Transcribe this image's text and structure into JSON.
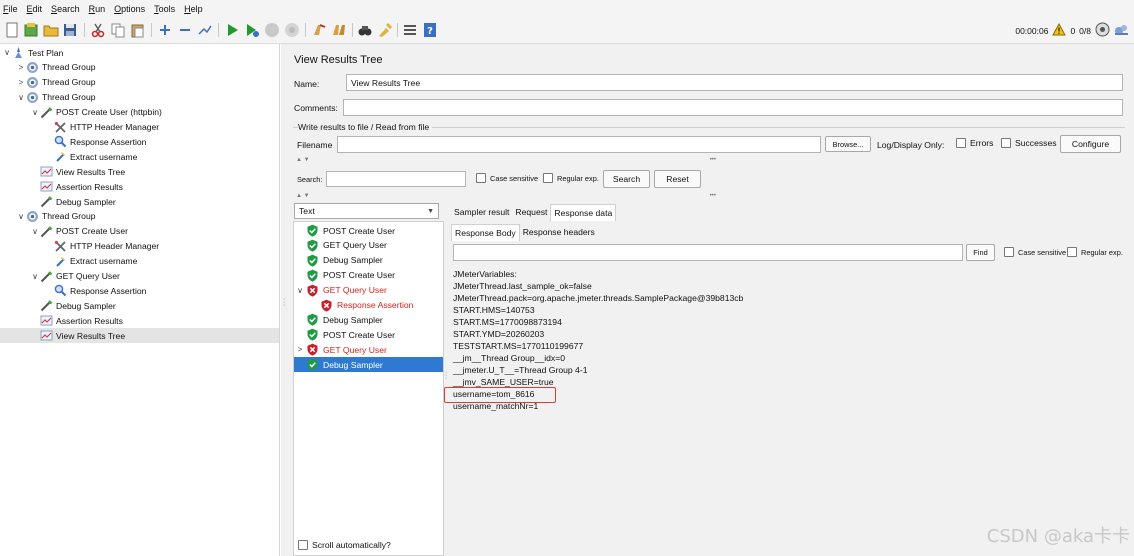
{
  "menu": [
    "File",
    "Edit",
    "Search",
    "Run",
    "Options",
    "Tools",
    "Help"
  ],
  "toolbar": {
    "icons": [
      "new-icon",
      "templates-icon",
      "open-icon",
      "save-icon",
      "cut-icon",
      "copy-icon",
      "paste-icon",
      "expand-icon",
      "collapse-icon",
      "toggle-icon",
      "start-icon",
      "start-no-pause-icon",
      "stop-icon",
      "shutdown-icon",
      "clear-icon",
      "clear-all-icon",
      "search-icon",
      "reset-search-icon",
      "function-helper-icon",
      "help-icon"
    ],
    "timer": "00:00:06",
    "warnings": "0",
    "threads": "0/8"
  },
  "tree": [
    {
      "label": "Test Plan",
      "level": 0,
      "twisty": "∨",
      "icon": "test-plan-icon"
    },
    {
      "label": "Thread Group",
      "level": 1,
      "twisty": ">",
      "icon": "gear-icon"
    },
    {
      "label": "Thread Group",
      "level": 1,
      "twisty": ">",
      "icon": "gear-icon"
    },
    {
      "label": "Thread Group",
      "level": 1,
      "twisty": "∨",
      "icon": "gear-icon"
    },
    {
      "label": "POST Create User (httpbin)",
      "level": 2,
      "twisty": "∨",
      "icon": "sampler-icon"
    },
    {
      "label": "HTTP Header Manager",
      "level": 3,
      "twisty": "",
      "icon": "header-manager-icon"
    },
    {
      "label": "Response Assertion",
      "level": 3,
      "twisty": "",
      "icon": "assertion-icon"
    },
    {
      "label": "Extract username",
      "level": 3,
      "twisty": "",
      "icon": "extractor-icon"
    },
    {
      "label": "View Results Tree",
      "level": 2,
      "twisty": "",
      "icon": "listener-icon"
    },
    {
      "label": "Assertion Results",
      "level": 2,
      "twisty": "",
      "icon": "listener-icon"
    },
    {
      "label": "Debug Sampler",
      "level": 2,
      "twisty": "",
      "icon": "sampler-icon"
    },
    {
      "label": "Thread Group",
      "level": 1,
      "twisty": "∨",
      "icon": "gear-icon"
    },
    {
      "label": "POST Create User",
      "level": 2,
      "twisty": "∨",
      "icon": "sampler-icon"
    },
    {
      "label": "HTTP Header Manager",
      "level": 3,
      "twisty": "",
      "icon": "header-manager-icon"
    },
    {
      "label": "Extract username",
      "level": 3,
      "twisty": "",
      "icon": "extractor-icon"
    },
    {
      "label": "GET Query User",
      "level": 2,
      "twisty": "∨",
      "icon": "sampler-icon"
    },
    {
      "label": "Response Assertion",
      "level": 3,
      "twisty": "",
      "icon": "assertion-icon"
    },
    {
      "label": "Debug Sampler",
      "level": 2,
      "twisty": "",
      "icon": "sampler-icon"
    },
    {
      "label": "Assertion Results",
      "level": 2,
      "twisty": "",
      "icon": "listener-icon"
    },
    {
      "label": "View Results Tree",
      "level": 2,
      "twisty": "",
      "icon": "listener-icon",
      "selected": true
    }
  ],
  "panel": {
    "title": "View Results Tree",
    "name_label": "Name:",
    "name_value": "View Results Tree",
    "comments_label": "Comments:",
    "comments_value": "",
    "file_group_title": "Write results to file / Read from file",
    "filename_label": "Filename",
    "filename_value": "",
    "browse_label": "Browse...",
    "log_display_label": "Log/Display Only:",
    "errors_label": "Errors",
    "successes_label": "Successes",
    "configure_label": "Configure",
    "search_label": "Search:",
    "search_value": "",
    "case_sensitive_label": "Case sensitive",
    "regex_label": "Regular exp.",
    "search_button": "Search",
    "reset_button": "Reset",
    "renderer": "Text",
    "scroll_auto_label": "Scroll automatically?"
  },
  "results": [
    {
      "label": "POST Create User",
      "status": "ok",
      "level": 0,
      "twisty": ""
    },
    {
      "label": "GET Query User",
      "status": "ok",
      "level": 0,
      "twisty": ""
    },
    {
      "label": "Debug Sampler",
      "status": "ok",
      "level": 0,
      "twisty": ""
    },
    {
      "label": "POST Create User",
      "status": "ok",
      "level": 0,
      "twisty": ""
    },
    {
      "label": "GET Query User",
      "status": "fail",
      "level": 0,
      "twisty": "∨"
    },
    {
      "label": "Response Assertion",
      "status": "fail",
      "level": 1,
      "twisty": ""
    },
    {
      "label": "Debug Sampler",
      "status": "ok",
      "level": 0,
      "twisty": ""
    },
    {
      "label": "POST Create User",
      "status": "ok",
      "level": 0,
      "twisty": ""
    },
    {
      "label": "GET Query User",
      "status": "fail",
      "level": 0,
      "twisty": ">"
    },
    {
      "label": "Debug Sampler",
      "status": "ok",
      "level": 0,
      "twisty": "",
      "selected": true
    }
  ],
  "detail": {
    "tabs": [
      "Sampler result",
      "Request",
      "Response data"
    ],
    "active_tab": "Response data",
    "subtabs": [
      "Response Body",
      "Response headers"
    ],
    "active_subtab": "Response Body",
    "find_value": "",
    "find_button": "Find",
    "case_sensitive_label": "Case sensitive",
    "regex_label": "Regular exp.",
    "response_lines": [
      "JMeterVariables:",
      "JMeterThread.last_sample_ok=false",
      "JMeterThread.pack=org.apache.jmeter.threads.SamplePackage@39b813cb",
      "START.HMS=140753",
      "START.MS=1770098873194",
      "START.YMD=20260203",
      "TESTSTART.MS=1770110199677",
      "__jm__Thread Group__idx=0",
      "__jmeter.U_T__=Thread Group 4-1",
      "__jmv_SAME_USER=true",
      "username=tom_8616",
      "username_matchNr=1"
    ]
  },
  "watermark": "CSDN @aka卡卡"
}
